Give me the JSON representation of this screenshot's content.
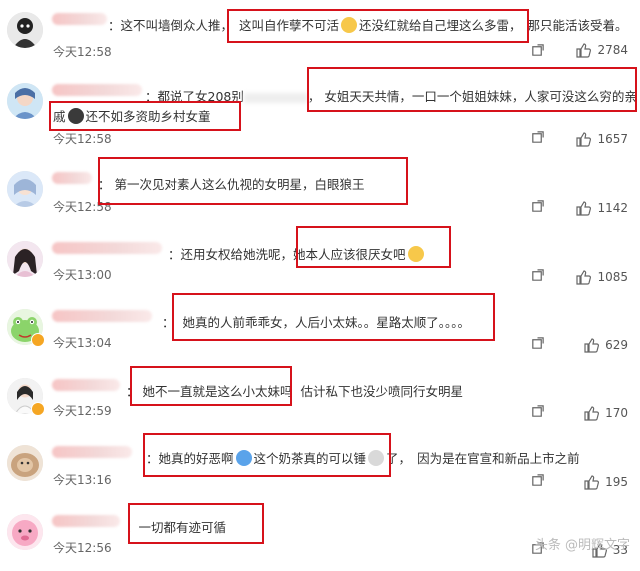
{
  "comments": [
    {
      "name_prefix": "",
      "text_a": "：这不叫墙倒众人推，",
      "text_b": "这叫自作孽不可活",
      "text_c": "还没红就给自己埋这么多雷，",
      "text_d": "那只能活该受着。",
      "time": "今天12:58",
      "likes": "2784"
    },
    {
      "text_a": "：都说了女208别",
      "text_b": "，",
      "text_c": "女姐天天共情，一口一个姐姐妹妹，人家可没这么穷的亲",
      "text_d": "戚",
      "text_e": "还不如多资助乡村女童",
      "time": "今天12:58",
      "likes": "1657"
    },
    {
      "text_a": "：",
      "text_b": "第一次见对素人这么仇视的女明星，白眼狼王",
      "time": "今天12:58",
      "likes": "1142"
    },
    {
      "text_a": "：还用女权给她洗呢，",
      "text_b": "她本人应该很厌女吧",
      "time": "今天13:00",
      "likes": "1085"
    },
    {
      "text_a": "：",
      "text_b": "她真的人前乖乖女，人后小太妹。。星路太顺了。。。。",
      "time": "今天13:04",
      "likes": "629"
    },
    {
      "text_a": "：",
      "text_b": "她不一直就是这么小太妹吗",
      "text_c": "估计私下也没少喷同行女明星",
      "time": "今天12:59",
      "likes": "170"
    },
    {
      "text_a": "：",
      "text_b": "她真的好恶啊",
      "text_c": "这个奶茶真的可以锤",
      "text_d": "了，",
      "text_e": "因为是在官宣和新品上市之前",
      "time": "今天13:16",
      "likes": "195"
    },
    {
      "text_a": "：",
      "text_b": "一切都有迹可循",
      "time": "今天12:56",
      "likes": "33"
    }
  ],
  "watermark": "头条 @明辉文字",
  "colors": {
    "highlight": "#d6121b",
    "text": "#333333",
    "muted": "#666666"
  },
  "icons": {
    "like": "thumbs-up-icon",
    "share": "share-icon"
  }
}
